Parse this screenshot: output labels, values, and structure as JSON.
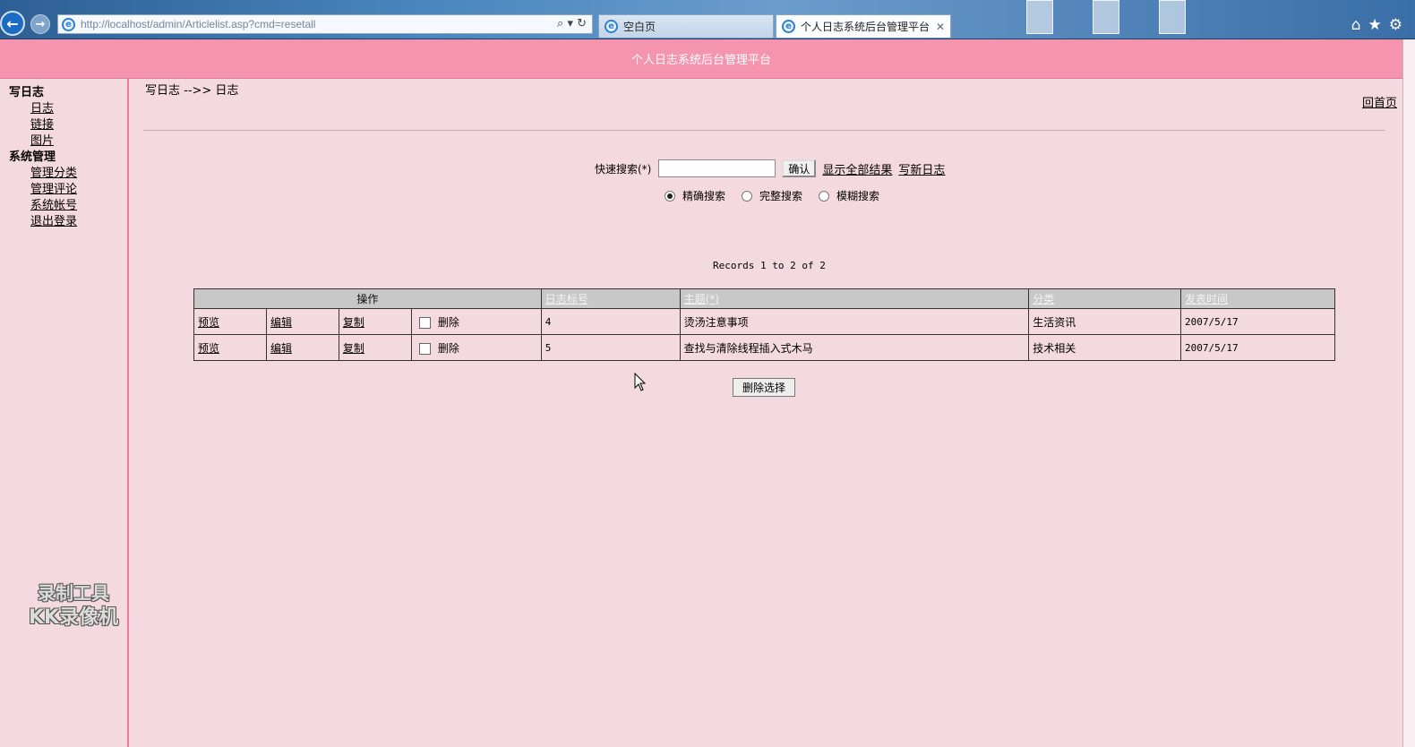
{
  "browser": {
    "url": "http://localhost/admin/Articlelist.asp?cmd=resetall",
    "tabs": [
      {
        "label": "空白页"
      },
      {
        "label": "个人日志系统后台管理平台"
      }
    ]
  },
  "header": {
    "title": "个人日志系统后台管理平台"
  },
  "sidebar": {
    "sections": [
      {
        "heading": "写日志",
        "items": [
          "日志",
          "链接",
          "图片"
        ]
      },
      {
        "heading": "系统管理",
        "items": [
          "管理分类",
          "管理评论",
          "系统帐号",
          "退出登录"
        ]
      }
    ]
  },
  "breadcrumb": "写日志 -->> 日志",
  "home_link": "回首页",
  "search": {
    "label": "快速搜索(*)",
    "value": "",
    "confirm_label": "确认",
    "show_all_label": "显示全部结果",
    "new_post_label": "写新日志",
    "modes": [
      {
        "label": "精确搜索",
        "checked": true
      },
      {
        "label": "完整搜索",
        "checked": false
      },
      {
        "label": "模糊搜索",
        "checked": false
      }
    ]
  },
  "records_text": "Records 1 to 2 of 2",
  "table": {
    "headers": {
      "operation": "操作",
      "id": "日志标号",
      "title": "主题(*)",
      "category": "分类",
      "date": "发表时间"
    },
    "rows": [
      {
        "preview": "预览",
        "edit": "编辑",
        "copy": "复制",
        "delete": "删除",
        "id": "4",
        "title": "烫汤注意事项",
        "category": "生活资讯",
        "date": "2007/5/17"
      },
      {
        "preview": "预览",
        "edit": "编辑",
        "copy": "复制",
        "delete": "删除",
        "id": "5",
        "title": "查找与清除线程插入式木马",
        "category": "技术相关",
        "date": "2007/5/17"
      }
    ]
  },
  "delete_selected_label": "删除选择",
  "watermark": {
    "line1": "录制工具",
    "line2": "KK录像机"
  }
}
